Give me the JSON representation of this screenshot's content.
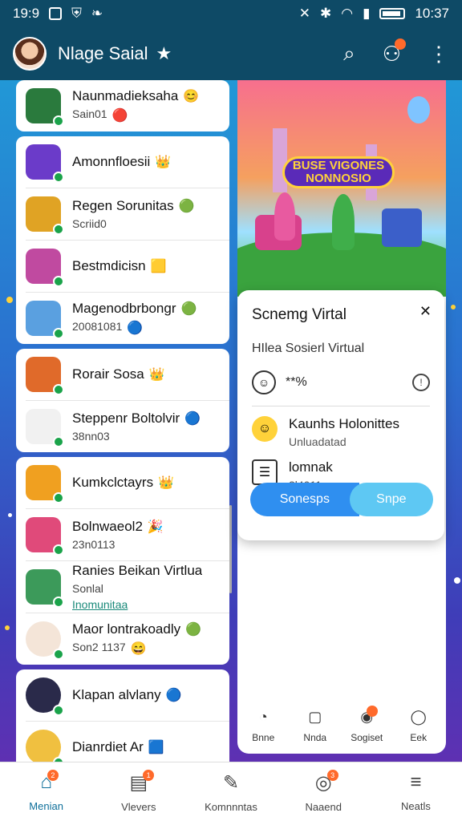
{
  "status_bar": {
    "time": "19:9",
    "right_time": "10:37"
  },
  "app_bar": {
    "title": "Nlage Saial"
  },
  "list": {
    "groups": [
      [
        {
          "name": "Naunmadieksaha",
          "sub": "Sain01",
          "thumb": "#2a7a3d",
          "round": false,
          "emoji": "😊",
          "sub_emoji": "🔴"
        }
      ],
      [
        {
          "name": "Amonnfloesii",
          "sub": "",
          "thumb": "#6b3bc9",
          "round": false,
          "emoji": "👑",
          "sub_emoji": ""
        },
        {
          "name": "Regen Sorunitas",
          "sub": "Scriid0",
          "thumb": "#e0a324",
          "round": false,
          "emoji": "🟢",
          "sub_emoji": ""
        },
        {
          "name": "Bestmdicisn",
          "sub": "",
          "thumb": "#c04aa0",
          "round": false,
          "emoji": "🟨",
          "sub_emoji": ""
        },
        {
          "name": "Magenodbrbongr",
          "sub": "20081081",
          "thumb": "#5aa0e0",
          "round": false,
          "emoji": "🟢",
          "sub_emoji": "🔵"
        }
      ],
      [
        {
          "name": "Rorair Sosa",
          "sub": "",
          "thumb": "#e06a2a",
          "round": false,
          "emoji": "👑",
          "sub_emoji": ""
        },
        {
          "name": "Steppenr Boltolvir",
          "sub": "38nn03",
          "thumb": "#f1f1f1",
          "round": false,
          "emoji": "🔵",
          "sub_emoji": ""
        }
      ],
      [
        {
          "name": "Kumkclctayrs",
          "sub": "",
          "thumb": "#f0a020",
          "round": false,
          "emoji": "👑",
          "sub_emoji": ""
        },
        {
          "name": "Bolnwaeol2",
          "sub": "23n0113",
          "thumb": "#e04a7a",
          "round": false,
          "emoji": "🎉",
          "sub_emoji": ""
        },
        {
          "name": "Ranies Beikan Virtlua",
          "sub": "Sonlal",
          "sub2": "Inomunitaa",
          "thumb": "#3c9a5a",
          "round": false,
          "emoji": "",
          "sub_emoji": ""
        },
        {
          "name": "Maor lontrakoadly",
          "sub": "Son2 1137",
          "thumb": "#f4e5d8",
          "round": true,
          "emoji": "🟢",
          "sub_emoji": "😄"
        }
      ],
      [
        {
          "name": "Klapan alvlany",
          "sub": "",
          "thumb": "#2a2a4a",
          "round": true,
          "emoji": "🔵",
          "sub_emoji": ""
        },
        {
          "name": "Dianrdiet Ar",
          "sub": "",
          "thumb": "#f0c040",
          "round": true,
          "emoji": "🟦",
          "sub_emoji": ""
        }
      ]
    ]
  },
  "banner": {
    "art_title": "BUSE VIGONES NONNOSIO"
  },
  "card": {
    "title": "Scnemg Virtal",
    "subtitle": "HIlea Sosierl Virtual",
    "rating": "**%",
    "info": "!",
    "items": [
      {
        "title": "Kaunhs Holonittes",
        "sub": "Unluadatad",
        "icon": "☺"
      },
      {
        "title": "lomnak",
        "sub": "2l4011",
        "icon": "☰"
      }
    ],
    "btn_primary": "Sonesps",
    "btn_secondary": "Snpe"
  },
  "mini_nav": [
    {
      "label": "Bnne",
      "icon": "◔"
    },
    {
      "label": "Nnda",
      "icon": "▢"
    },
    {
      "label": "Sogiset",
      "icon": "◉"
    },
    {
      "label": "Eek",
      "icon": "◯"
    }
  ],
  "bottom_nav": [
    {
      "label": "Menian",
      "icon": "⌂",
      "badge": "2"
    },
    {
      "label": "Vlevers",
      "icon": "▤",
      "badge": "1"
    },
    {
      "label": "Komnnntas",
      "icon": "✎",
      "badge": ""
    },
    {
      "label": "Naaend",
      "icon": "◎",
      "badge": "3"
    },
    {
      "label": "Neatls",
      "icon": "≡",
      "badge": ""
    }
  ]
}
